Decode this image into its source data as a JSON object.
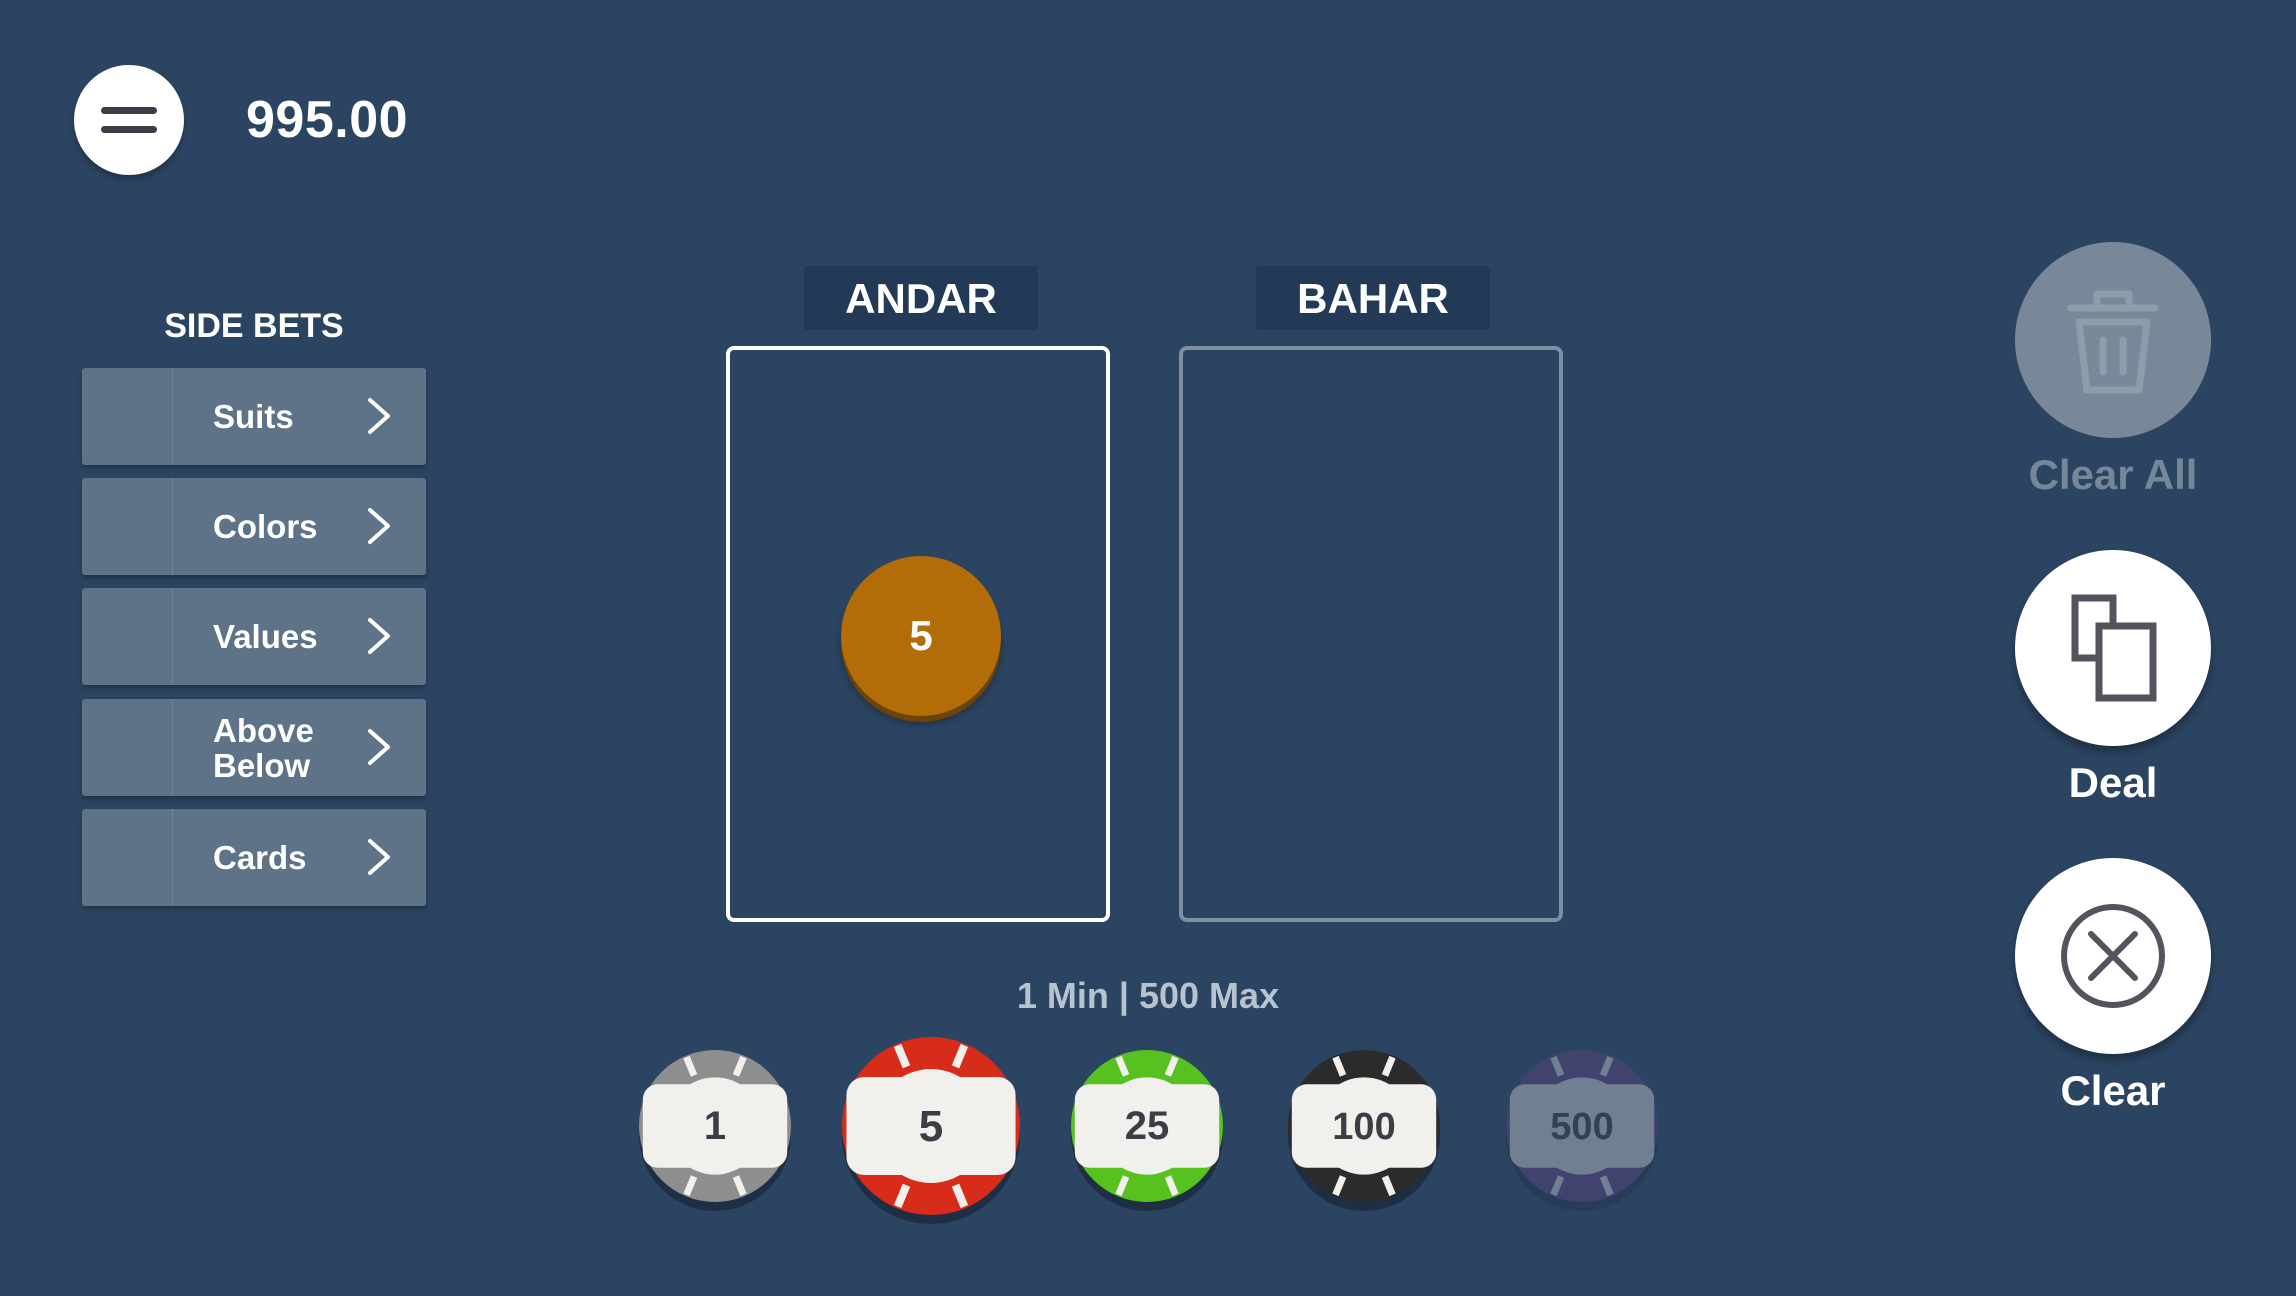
{
  "header": {
    "balance": "995.00",
    "menu_icon": "hamburger-menu-icon"
  },
  "side_bets": {
    "title": "SIDE BETS",
    "items": [
      {
        "label": "Suits"
      },
      {
        "label": "Colors"
      },
      {
        "label": "Values"
      },
      {
        "label": "Above Below"
      },
      {
        "label": "Cards"
      }
    ],
    "chevron_icon": "chevron-right-icon"
  },
  "bets": {
    "andar": {
      "label": "ANDAR",
      "chip_value": "5",
      "chip_color": "#b26d08"
    },
    "bahar": {
      "label": "BAHAR"
    }
  },
  "limits": "1 Min | 500 Max",
  "chips": [
    {
      "value": "1",
      "color": "#8e8e8e",
      "selected": false,
      "enabled": true
    },
    {
      "value": "5",
      "color": "#d82c1b",
      "selected": true,
      "enabled": true
    },
    {
      "value": "25",
      "color": "#57c21f",
      "selected": false,
      "enabled": true
    },
    {
      "value": "100",
      "color": "#2b2b2b",
      "selected": false,
      "enabled": true
    },
    {
      "value": "500",
      "color": "#6a3f86",
      "selected": false,
      "enabled": false
    }
  ],
  "controls": {
    "clear_all": {
      "label": "Clear All",
      "icon": "trash-icon",
      "enabled": false
    },
    "deal": {
      "label": "Deal",
      "icon": "cards-icon",
      "enabled": true
    },
    "clear": {
      "label": "Clear",
      "icon": "close-circle-icon",
      "enabled": true
    }
  },
  "colors": {
    "background": "#2b4461",
    "side_button": "#5e7288",
    "bet_header": "#223a56",
    "icon_dark": "#56525e"
  }
}
